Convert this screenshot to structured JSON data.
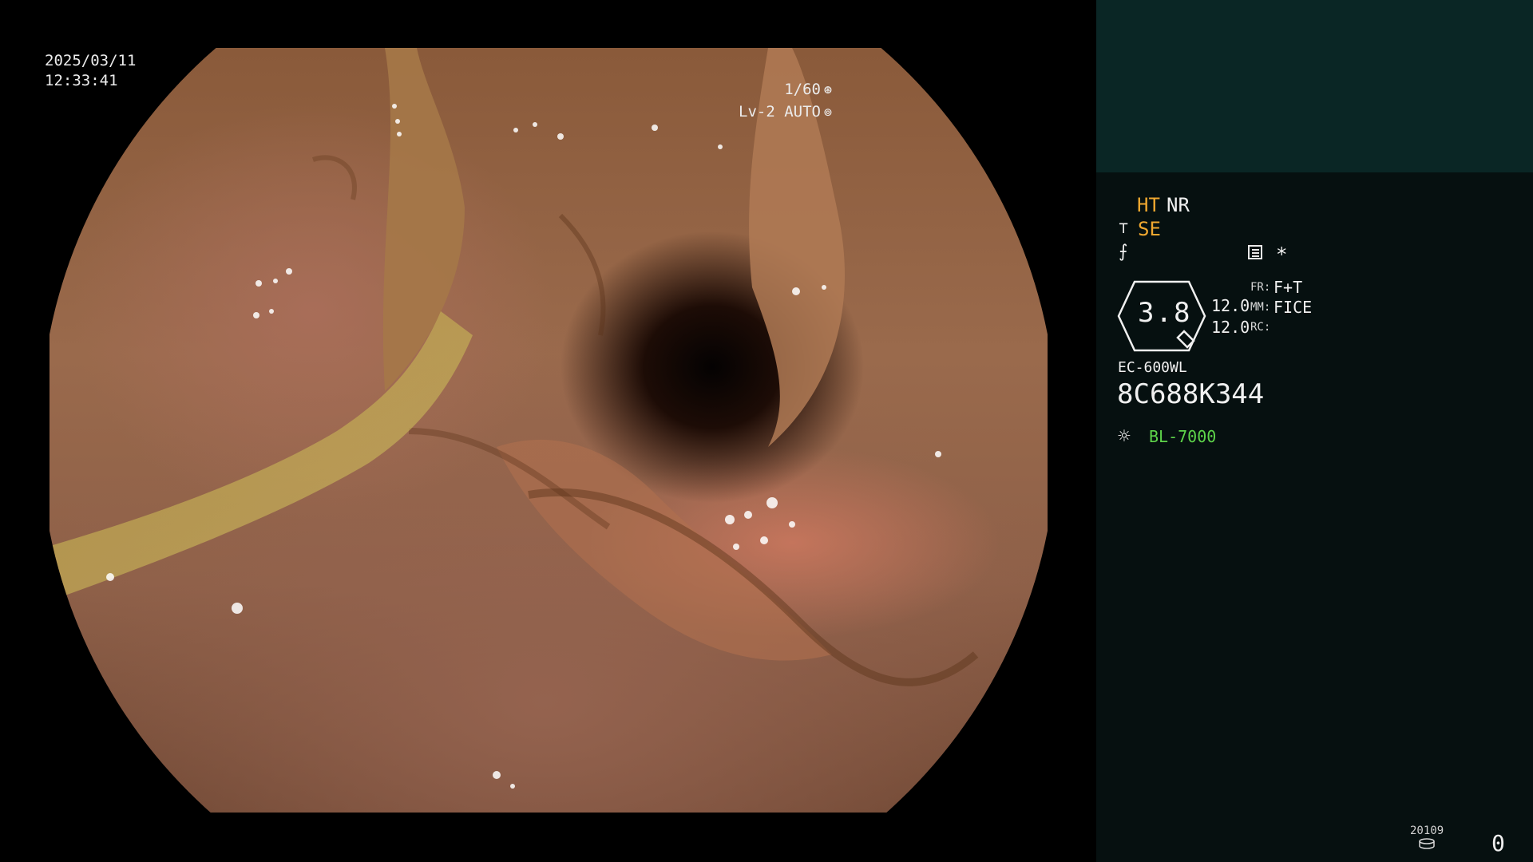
{
  "overlay": {
    "date": "2025/03/11",
    "time": "12:33:41",
    "shutter": "1/60",
    "shutter_icon": "aperture-icon",
    "level": "Lv-2 AUTO",
    "auto_icon": "iris-icon"
  },
  "panel": {
    "ht": "HT",
    "nr": "NR",
    "se": "SE",
    "se_icon": "enhance-icon",
    "flag_icon": "slash-icon",
    "menu_icon": "menu-icon",
    "star": "*",
    "zoom_value": "3.8",
    "zoom_a": "12.0",
    "zoom_b": "12.0",
    "fr_label": "FR:",
    "fr_value": "F+T",
    "mm_label": "MM:",
    "mm_value": "FICE",
    "rc_label": "RC:",
    "scope_model": "EC-600WL",
    "scope_serial": "8C688K344",
    "light_icon": "sun-icon",
    "light_source": "BL-7000",
    "counter_label": "20109",
    "disk_icon": "disk-icon",
    "counter_value": "0"
  },
  "colors": {
    "panel_top": "#0a2625",
    "panel_bg": "#061010",
    "orange": "#f0a830",
    "green": "#5ed44a"
  }
}
